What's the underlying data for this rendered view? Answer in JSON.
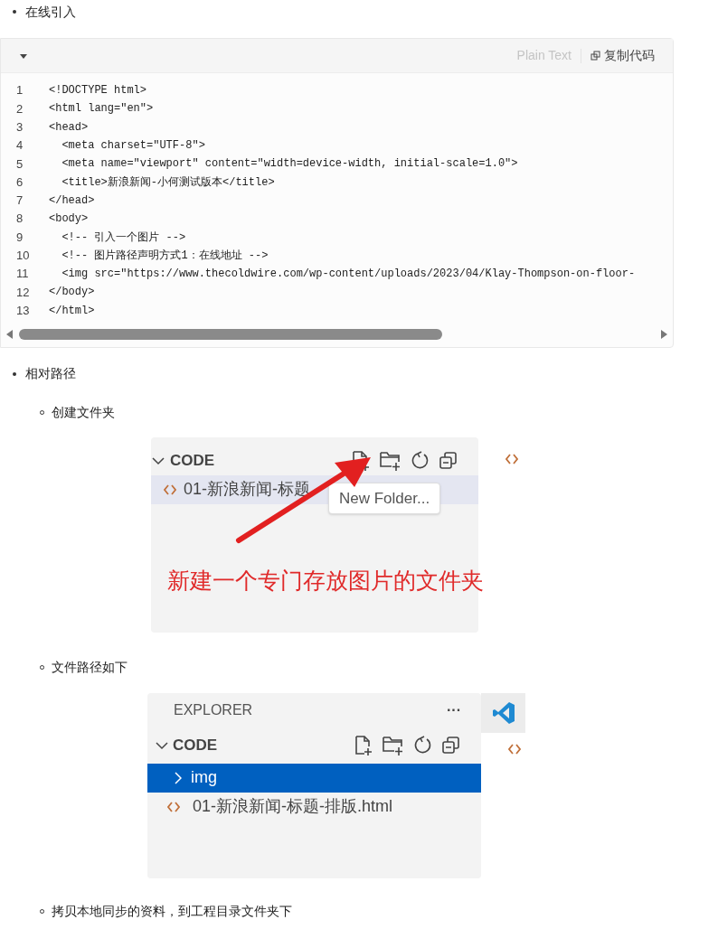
{
  "section_online": {
    "text": "在线引入"
  },
  "code_block": {
    "language": "Plain Text",
    "copy_label": "复制代码",
    "expanded": true,
    "lines": [
      {
        "number": "1",
        "text": "<!DOCTYPE html>"
      },
      {
        "number": "2",
        "text": "<html lang=\"en\">"
      },
      {
        "number": "3",
        "text": "<head>"
      },
      {
        "number": "4",
        "text": "  <meta charset=\"UTF-8\">"
      },
      {
        "number": "5",
        "text": "  <meta name=\"viewport\" content=\"width=device-width, initial-scale=1.0\">"
      },
      {
        "number": "6",
        "text": "  <title>新浪新闻-小何测试版本</title>"
      },
      {
        "number": "7",
        "text": "</head>"
      },
      {
        "number": "8",
        "text": "<body>"
      },
      {
        "number": "9",
        "text": "  <!-- 引入一个图片 -->"
      },
      {
        "number": "10",
        "text": "  <!-- 图片路径声明方式1：在线地址 -->"
      },
      {
        "number": "11",
        "text": "  <img src=\"https://www.thecoldwire.com/wp-content/uploads/2023/04/Klay-Thompson-on-floor-"
      },
      {
        "number": "12",
        "text": "</body>"
      },
      {
        "number": "13",
        "text": "</html>"
      }
    ]
  },
  "section_relative": {
    "text": "相对路径"
  },
  "step_create": {
    "text": "创建文件夹"
  },
  "screenshot_create": {
    "section": "CODE",
    "file": {
      "name": "01-新浪新闻-标题",
      "selected": true
    },
    "tooltip": "New Folder...",
    "annotation": "新建一个专门存放图片的文件夹"
  },
  "step_path": {
    "text": "文件路径如下"
  },
  "screenshot_path": {
    "title": "EXPLORER",
    "more": "···",
    "section": "CODE",
    "rows": [
      {
        "kind": "folder",
        "name": "img",
        "selected": true
      },
      {
        "kind": "file",
        "name": "01-新浪新闻-标题-排版.html",
        "selected": false
      }
    ]
  },
  "step_copy": {
    "text": "拷贝本地同步的资料，到工程目录文件夹下"
  }
}
